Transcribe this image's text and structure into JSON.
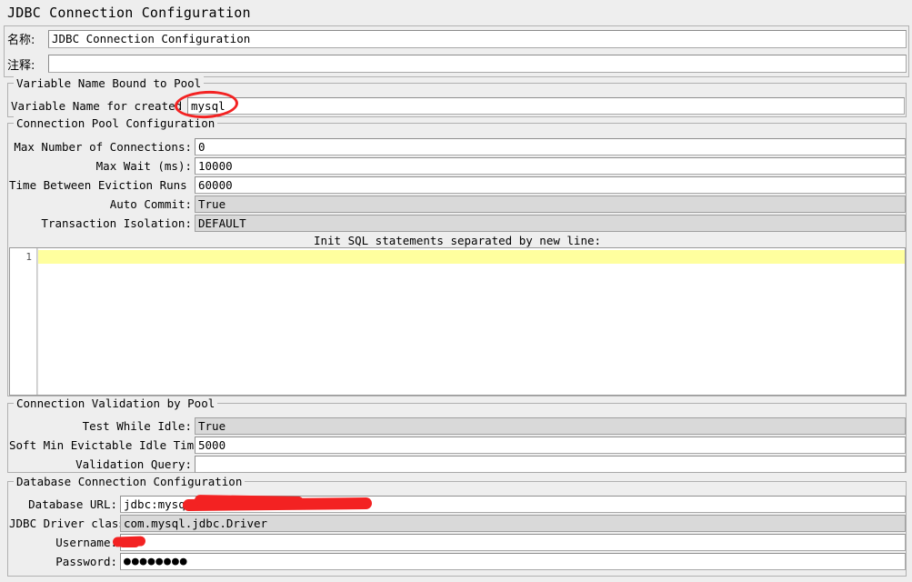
{
  "window": {
    "title": "JDBC Connection Configuration"
  },
  "header": {
    "name_label": "名称:",
    "name_value": "JDBC Connection Configuration",
    "comment_label": "注释:",
    "comment_value": ""
  },
  "variable_name_group": {
    "title": "Variable Name Bound to Pool",
    "pool_label": "Variable Name for created pool:",
    "pool_value": "mysql"
  },
  "connection_pool_group": {
    "title": "Connection Pool Configuration",
    "rows": [
      {
        "label": "Max Number of Connections:",
        "value": "0",
        "type": "text"
      },
      {
        "label": "Max Wait (ms):",
        "value": "10000",
        "type": "text"
      },
      {
        "label": "Time Between Eviction Runs (ms):",
        "value": "60000",
        "type": "text"
      },
      {
        "label": "Auto Commit:",
        "value": "True",
        "type": "combo"
      },
      {
        "label": "Transaction Isolation:",
        "value": "DEFAULT",
        "type": "combo"
      }
    ],
    "init_sql_caption": "Init SQL statements separated by new line:",
    "editor_line_number": "1",
    "editor_content": ""
  },
  "validation_group": {
    "title": "Connection Validation by Pool",
    "rows": [
      {
        "label": "Test While Idle:",
        "value": "True",
        "type": "combo"
      },
      {
        "label": "Soft Min Evictable Idle Time(ms):",
        "value": "5000",
        "type": "text"
      },
      {
        "label": "Validation Query:",
        "value": "",
        "type": "text"
      }
    ]
  },
  "database_group": {
    "title": "Database Connection Configuration",
    "rows": [
      {
        "label": "Database URL:",
        "value": "jdbc:mysql://",
        "type": "text"
      },
      {
        "label": "JDBC Driver class:",
        "value": "com.mysql.jdbc.Driver",
        "type": "combo"
      },
      {
        "label": "Username:",
        "value": "",
        "type": "text"
      },
      {
        "label": "Password:",
        "value": "●●●●●●●●",
        "type": "password"
      }
    ]
  },
  "annotations": {
    "highlight_color": "#f32222",
    "ellipse_target": "mysql",
    "redacted_fields": [
      "Database URL",
      "Username"
    ]
  },
  "colors": {
    "background": "#eeeeee",
    "field_background": "#ffffff",
    "combo_background": "#d9d9d9",
    "editor_active_line": "#ffff9e",
    "border": "#b0b0b0"
  }
}
